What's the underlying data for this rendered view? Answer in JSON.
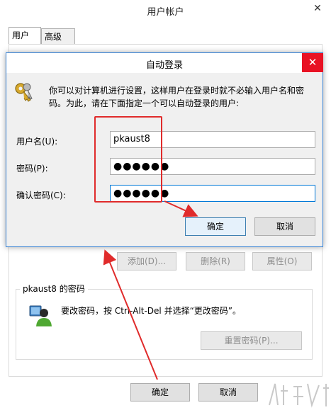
{
  "back_window": {
    "title": "用户帐户",
    "close_glyph": "✕",
    "tabs": [
      {
        "label": "用户"
      },
      {
        "label": "高级"
      }
    ],
    "buttons": {
      "add": "添加(D)...",
      "remove": "删除(R)",
      "properties": "属性(O)"
    },
    "password_group": {
      "label": "pkaust8 的密码",
      "text": "要改密码，按 Ctrl-Alt-Del 并选择“更改密码”。",
      "reset_button": "重置密码(P)...",
      "icon": "user-icon"
    },
    "ok_label": "确定",
    "cancel_label": "取消"
  },
  "dialog": {
    "title": "自动登录",
    "close_glyph": "✕",
    "icon": "keys-icon",
    "description": "你可以对计算机进行设置，这样用户在登录时就不必输入用户名和密码。为此，请在下面指定一个可以自动登录的用户:",
    "fields": {
      "username": {
        "label": "用户名(U):",
        "value": "pkaust8"
      },
      "password": {
        "label": "密码(P):",
        "value": "●●●●●●"
      },
      "confirm": {
        "label": "确认密码(C):",
        "value": "●●●●●●"
      }
    },
    "ok_label": "确定",
    "cancel_label": "取消"
  },
  "colors": {
    "annotation": "#e02b2b",
    "dialog_border": "#3d86d6",
    "close_hover": "#e81123"
  }
}
